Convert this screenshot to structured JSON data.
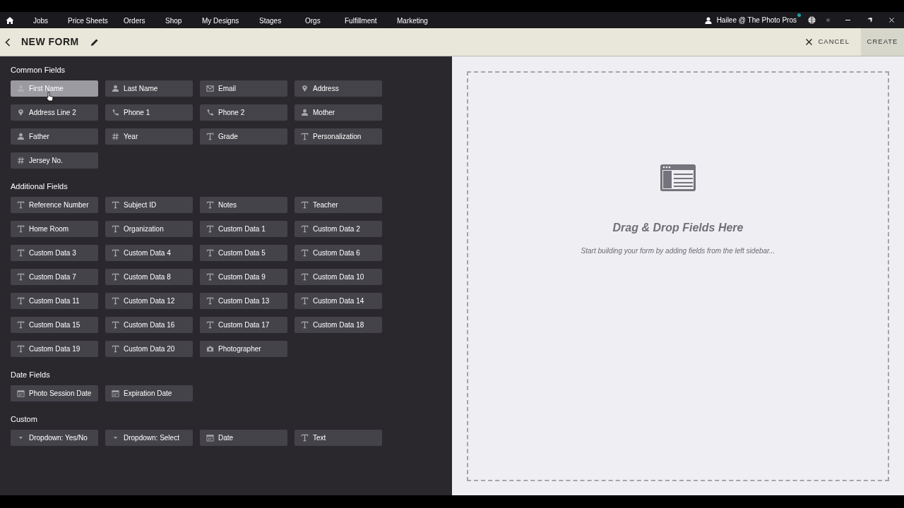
{
  "nav": {
    "items": [
      "Jobs",
      "Price Sheets",
      "Orders",
      "Shop",
      "My Designs",
      "Stages",
      "Orgs",
      "Fulfillment",
      "Marketing"
    ],
    "user": "Hailee @ The Photo Pros"
  },
  "header": {
    "title": "NEW FORM",
    "cancel": "CANCEL",
    "create": "CREATE"
  },
  "sections": [
    {
      "title": "Common Fields",
      "fields": [
        {
          "kind": "person",
          "label": "First Name",
          "hovered": true
        },
        {
          "kind": "person",
          "label": "Last Name",
          "hovered": false
        },
        {
          "kind": "email",
          "label": "Email",
          "hovered": false
        },
        {
          "kind": "pin",
          "label": "Address",
          "hovered": false
        },
        {
          "kind": "pin",
          "label": "Address Line 2",
          "hovered": false
        },
        {
          "kind": "phone",
          "label": "Phone 1",
          "hovered": false
        },
        {
          "kind": "phone",
          "label": "Phone 2",
          "hovered": false
        },
        {
          "kind": "person",
          "label": "Mother",
          "hovered": false
        },
        {
          "kind": "person",
          "label": "Father",
          "hovered": false
        },
        {
          "kind": "number",
          "label": "Year",
          "hovered": false
        },
        {
          "kind": "text",
          "label": "Grade",
          "hovered": false
        },
        {
          "kind": "text",
          "label": "Personalization",
          "hovered": false
        },
        {
          "kind": "number",
          "label": "Jersey No.",
          "hovered": false
        }
      ]
    },
    {
      "title": "Additional Fields",
      "fields": [
        {
          "kind": "text",
          "label": "Reference Number",
          "hovered": false
        },
        {
          "kind": "text",
          "label": "Subject ID",
          "hovered": false
        },
        {
          "kind": "text",
          "label": "Notes",
          "hovered": false
        },
        {
          "kind": "text",
          "label": "Teacher",
          "hovered": false
        },
        {
          "kind": "text",
          "label": "Home Room",
          "hovered": false
        },
        {
          "kind": "text",
          "label": "Organization",
          "hovered": false
        },
        {
          "kind": "text",
          "label": "Custom Data 1",
          "hovered": false
        },
        {
          "kind": "text",
          "label": "Custom Data 2",
          "hovered": false
        },
        {
          "kind": "text",
          "label": "Custom Data 3",
          "hovered": false
        },
        {
          "kind": "text",
          "label": "Custom Data 4",
          "hovered": false
        },
        {
          "kind": "text",
          "label": "Custom Data 5",
          "hovered": false
        },
        {
          "kind": "text",
          "label": "Custom Data 6",
          "hovered": false
        },
        {
          "kind": "text",
          "label": "Custom Data 7",
          "hovered": false
        },
        {
          "kind": "text",
          "label": "Custom Data 8",
          "hovered": false
        },
        {
          "kind": "text",
          "label": "Custom Data 9",
          "hovered": false
        },
        {
          "kind": "text",
          "label": "Custom Data 10",
          "hovered": false
        },
        {
          "kind": "text",
          "label": "Custom Data 11",
          "hovered": false
        },
        {
          "kind": "text",
          "label": "Custom Data 12",
          "hovered": false
        },
        {
          "kind": "text",
          "label": "Custom Data 13",
          "hovered": false
        },
        {
          "kind": "text",
          "label": "Custom Data 14",
          "hovered": false
        },
        {
          "kind": "text",
          "label": "Custom Data 15",
          "hovered": false
        },
        {
          "kind": "text",
          "label": "Custom Data 16",
          "hovered": false
        },
        {
          "kind": "text",
          "label": "Custom Data 17",
          "hovered": false
        },
        {
          "kind": "text",
          "label": "Custom Data 18",
          "hovered": false
        },
        {
          "kind": "text",
          "label": "Custom Data 19",
          "hovered": false
        },
        {
          "kind": "text",
          "label": "Custom Data 20",
          "hovered": false
        },
        {
          "kind": "camera",
          "label": "Photographer",
          "hovered": false
        }
      ]
    },
    {
      "title": "Date Fields",
      "fields": [
        {
          "kind": "date",
          "label": "Photo Session Date",
          "hovered": false
        },
        {
          "kind": "date",
          "label": "Expiration Date",
          "hovered": false
        }
      ]
    },
    {
      "title": "Custom",
      "fields": [
        {
          "kind": "dropdown",
          "label": "Dropdown: Yes/No",
          "hovered": false
        },
        {
          "kind": "dropdown",
          "label": "Dropdown: Select",
          "hovered": false
        },
        {
          "kind": "date",
          "label": "Date",
          "hovered": false
        },
        {
          "kind": "text",
          "label": "Text",
          "hovered": false
        }
      ]
    }
  ],
  "drop_zone": {
    "title": "Drag & Drop Fields Here",
    "hint": "Start building your form by adding fields from the left sidebar..."
  }
}
